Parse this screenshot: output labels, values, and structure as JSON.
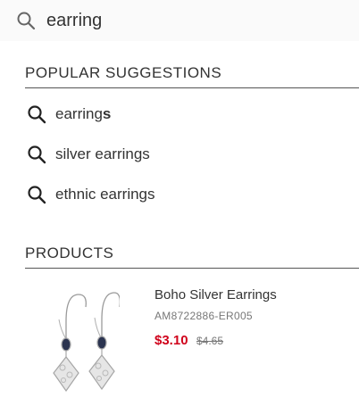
{
  "search": {
    "value": "earring"
  },
  "suggestions": {
    "title": "POPULAR SUGGESTIONS",
    "items": [
      {
        "prefix": "earring",
        "bold": "s"
      },
      {
        "prefix": "silver earrings",
        "bold": ""
      },
      {
        "prefix": "ethnic earrings",
        "bold": ""
      }
    ]
  },
  "products": {
    "title": "PRODUCTS",
    "items": [
      {
        "name": "Boho Silver Earrings",
        "sku": "AM8722886-ER005",
        "price": "$3.10",
        "old_price": "$4.65"
      }
    ]
  },
  "colors": {
    "accent_price": "#d0021b",
    "text": "#333333",
    "muted": "#777777"
  }
}
